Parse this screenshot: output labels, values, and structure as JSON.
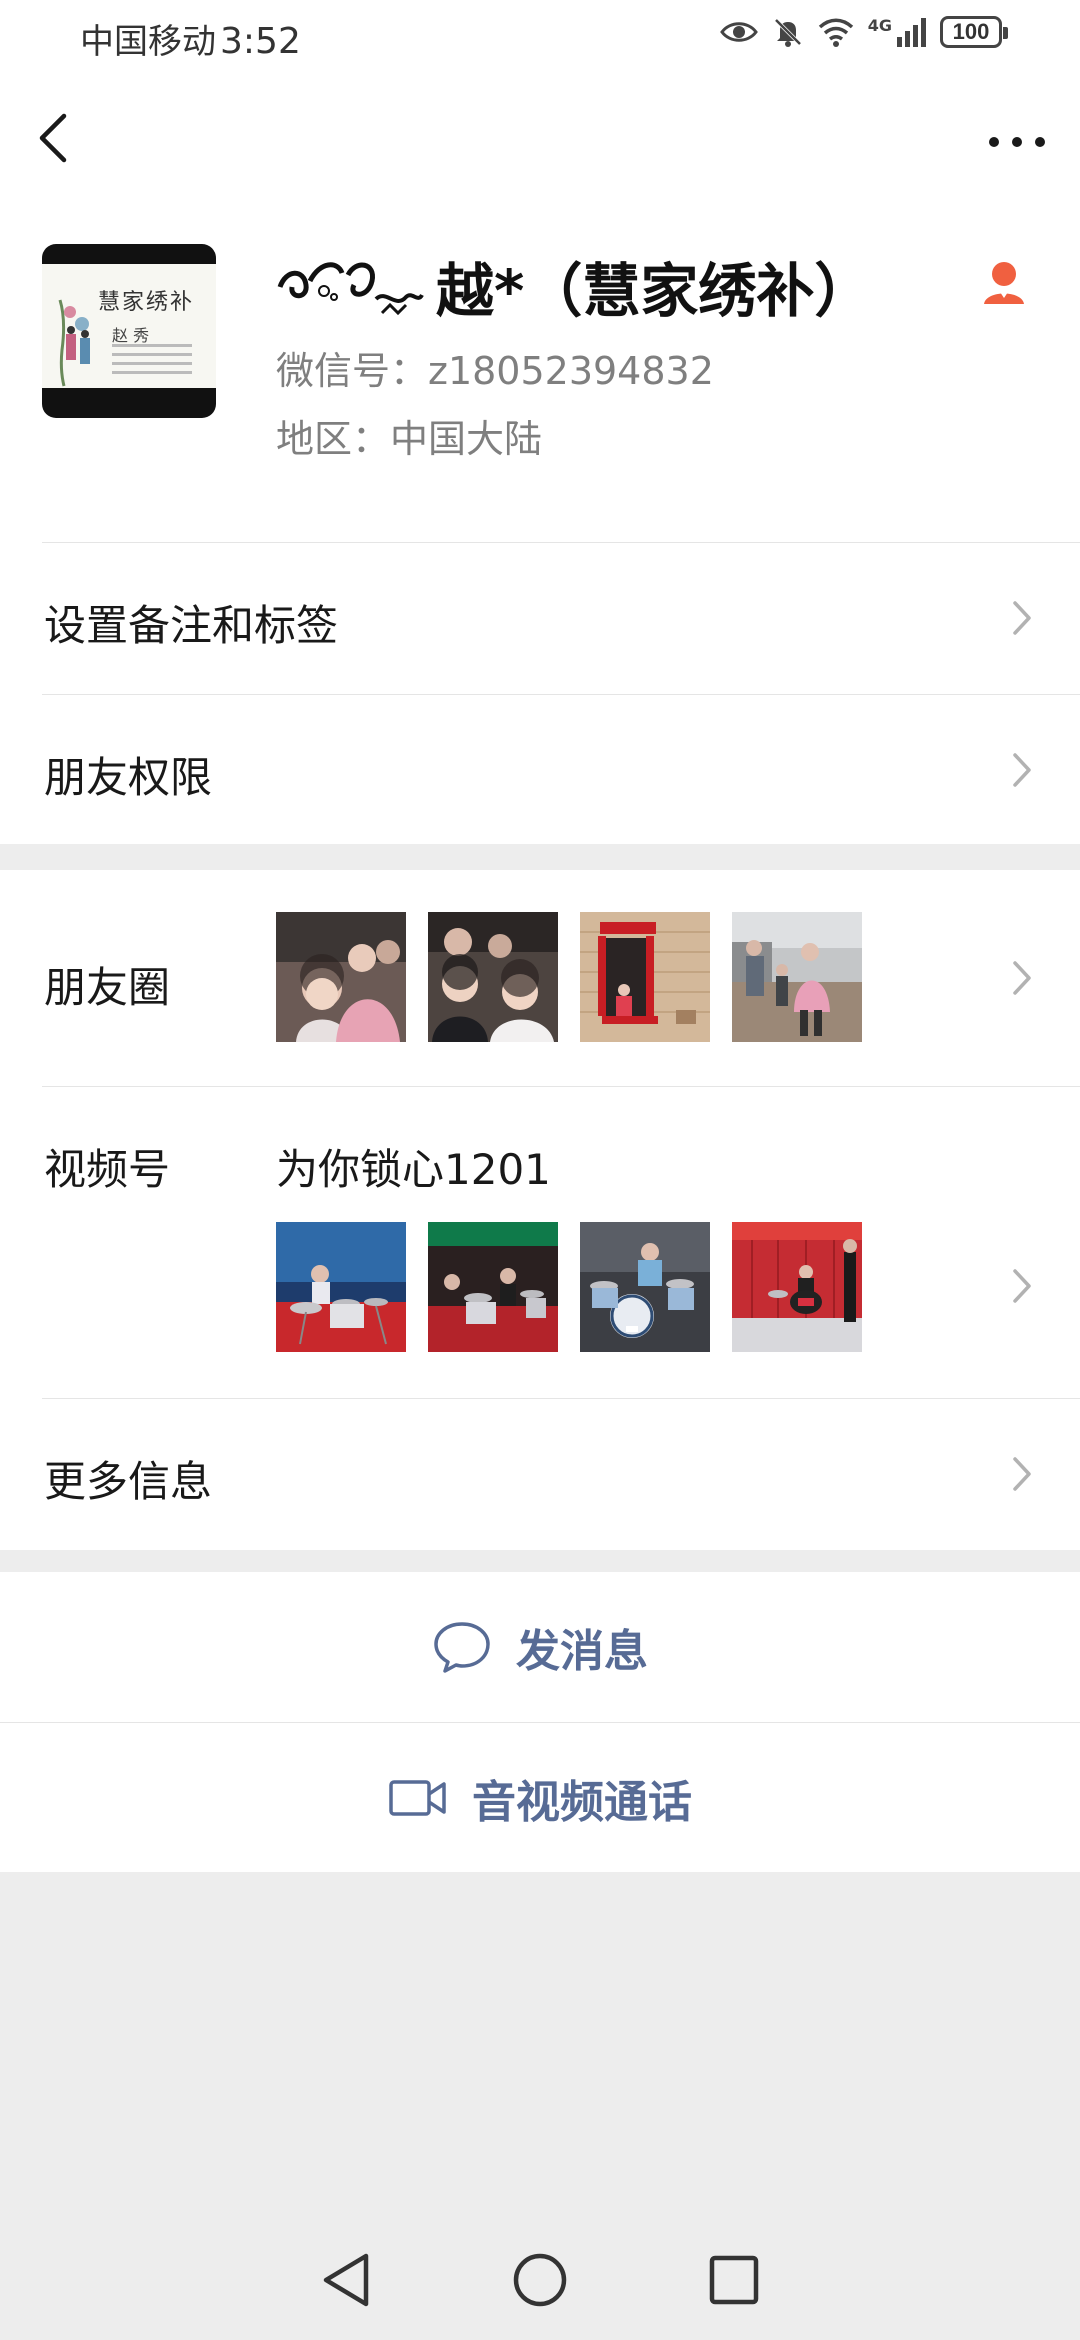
{
  "status_bar": {
    "carrier": "中国移动",
    "time": "3:52",
    "network": "4G",
    "battery": "100",
    "icons": [
      "eye-icon",
      "bell-muted-icon",
      "wifi-icon",
      "signal-icon",
      "battery-icon"
    ]
  },
  "nav": {
    "back_icon": "chevron-left-icon",
    "more_icon": "more-dots-icon"
  },
  "profile": {
    "nickname": "越*（慧家绣补）",
    "wechat_id": "微信号：z18052394832",
    "region": "地区：中国大陆",
    "avatar_card_title": "慧家绣补",
    "avatar_card_name": "赵 秀"
  },
  "rows": {
    "remarks": "设置备注和标签",
    "permissions": "朋友权限",
    "moments": "朋友圈",
    "channels": "视频号",
    "channels_name": "为你锁心1201",
    "more_info": "更多信息"
  },
  "actions": {
    "message": "发消息",
    "call": "音视频通话"
  },
  "colors": {
    "link_blue": "#576b95",
    "contact_badge": "#f06040",
    "background": "#ededed"
  }
}
